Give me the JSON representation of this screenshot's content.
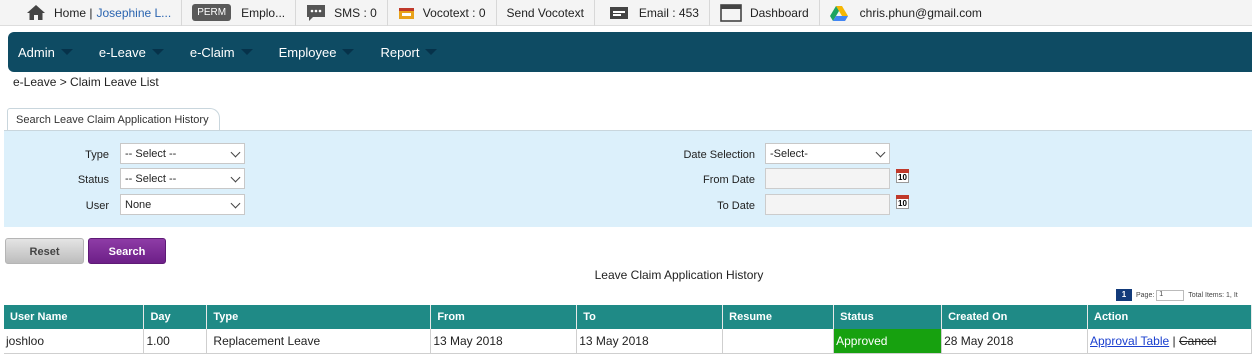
{
  "topbar": {
    "home_label": "Home |",
    "user_name": "Josephine L...",
    "perm_badge": "PERM",
    "employee_label": "Emplo...",
    "sms_label": "SMS : 0",
    "vocotext_label": "Vocotext : 0",
    "send_vocotext_label": "Send Vocotext",
    "email_label": "Email : 453",
    "dashboard_label": "Dashboard",
    "account_email": "chris.phun@gmail.com"
  },
  "nav": {
    "items": [
      {
        "label": "Admin"
      },
      {
        "label": "e-Leave"
      },
      {
        "label": "e-Claim"
      },
      {
        "label": "Employee"
      },
      {
        "label": "Report"
      }
    ]
  },
  "breadcrumb": "e-Leave > Claim Leave List",
  "search": {
    "tab_label": "Search Leave Claim Application History",
    "type_label": "Type",
    "type_value": "-- Select --",
    "status_label": "Status",
    "status_value": "-- Select --",
    "user_label": "User",
    "user_value": "None",
    "date_selection_label": "Date Selection",
    "date_selection_value": "-Select-",
    "from_date_label": "From Date",
    "to_date_label": "To Date",
    "calendar_day": "10",
    "reset_label": "Reset",
    "search_label": "Search"
  },
  "table": {
    "title": "Leave Claim Application History",
    "pager": {
      "current_page": "1",
      "page_label": "Page:",
      "page_select": "1",
      "total_label": "Total Items: 1, It"
    },
    "columns": [
      "User Name",
      "Day",
      "Type",
      "From",
      "To",
      "Resume",
      "Status",
      "Created On",
      "Action"
    ],
    "rows": [
      {
        "user_name": "joshloo",
        "day": "1.00",
        "type": "Replacement Leave",
        "from": "13 May 2018",
        "to": "13 May 2018",
        "resume": "",
        "status": "Approved",
        "created_on": "28 May 2018",
        "action_approval": "Approval Table",
        "action_separator": "|",
        "action_cancel": "Cancel"
      }
    ]
  },
  "colors": {
    "nav_bg": "#0e4b63",
    "header_bg": "#1f8a86",
    "status_approved": "#17a10f",
    "search_btn": "#6d1f88",
    "panel_bg": "#dcf0fb"
  }
}
